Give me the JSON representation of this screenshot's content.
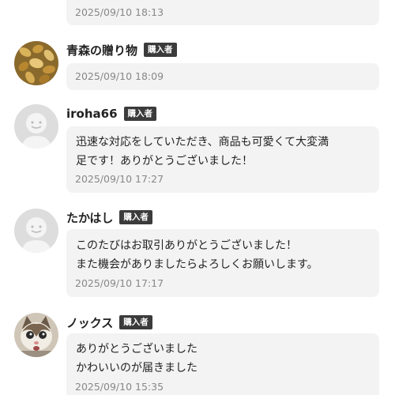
{
  "reviews": [
    {
      "name": "",
      "badge": "",
      "lines": [],
      "time": "2025/09/10 18:13"
    },
    {
      "name": "青森の贈り物",
      "badge": "購入者",
      "lines": [],
      "time": "2025/09/10 18:09",
      "avatar": "nuts-photo-icon"
    },
    {
      "name": "iroha66",
      "badge": "購入者",
      "lines": [
        "迅速な対応をしていただき、商品も可愛くて大変満",
        "足です！ありがとうございました！"
      ],
      "time": "2025/09/10 17:27",
      "avatar": "default-user-icon"
    },
    {
      "name": "たかはし",
      "badge": "購入者",
      "lines": [
        "このたびはお取引ありがとうございました！",
        "また機会がありましたらよろしくお願いします。"
      ],
      "time": "2025/09/10 17:17",
      "avatar": "default-user-icon"
    },
    {
      "name": "ノックス",
      "badge": "購入者",
      "lines": [
        "ありがとうございました",
        "かわいいのが届きました"
      ],
      "time": "2025/09/10 15:35",
      "avatar": "cat-photo-icon"
    }
  ],
  "colors": {
    "bubble": "#f3f3f3",
    "badge": "#3b3b3b",
    "timestamp": "#888888"
  }
}
